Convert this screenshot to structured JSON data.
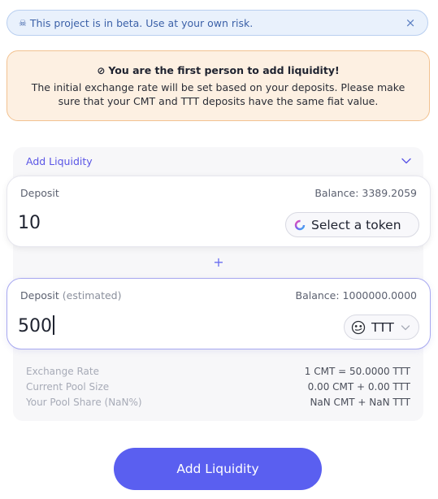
{
  "banner": {
    "icon": "skull-icon",
    "text": "This project is in beta. Use at your own risk.",
    "close_label": "×"
  },
  "notice": {
    "icon": "wave-icon",
    "title": "You are the first person to add liquidity!",
    "body": "The initial exchange rate will be set based on your deposits. Please make sure that your CMT and TTT deposits have the same fiat value."
  },
  "panel": {
    "title": "Add Liquidity"
  },
  "deposit1": {
    "label": "Deposit",
    "balance": "Balance: 3389.2059",
    "amount": "10",
    "token_button": "Select a token",
    "token_icon": "spinner-icon"
  },
  "plus_sign": "+",
  "deposit2": {
    "label": "Deposit",
    "label_extra": "(estimated)",
    "balance": "Balance: 1000000.0000",
    "amount": "500",
    "token_button": "TTT",
    "token_icon": "smirk-face-icon"
  },
  "stats": [
    {
      "label": "Exchange Rate",
      "value": "1 CMT = 50.0000 TTT"
    },
    {
      "label": "Current Pool Size",
      "value": "0.00 CMT + 0.00 TTT"
    },
    {
      "label": "Your Pool Share (NaN%)",
      "value": "NaN CMT + NaN TTT"
    }
  ],
  "submit_label": "Add Liquidity",
  "colors": {
    "accent": "#5a5ff0",
    "banner_bg": "#e9f1fc",
    "notice_bg": "#fdf0e2",
    "notice_border": "#f2c291"
  }
}
